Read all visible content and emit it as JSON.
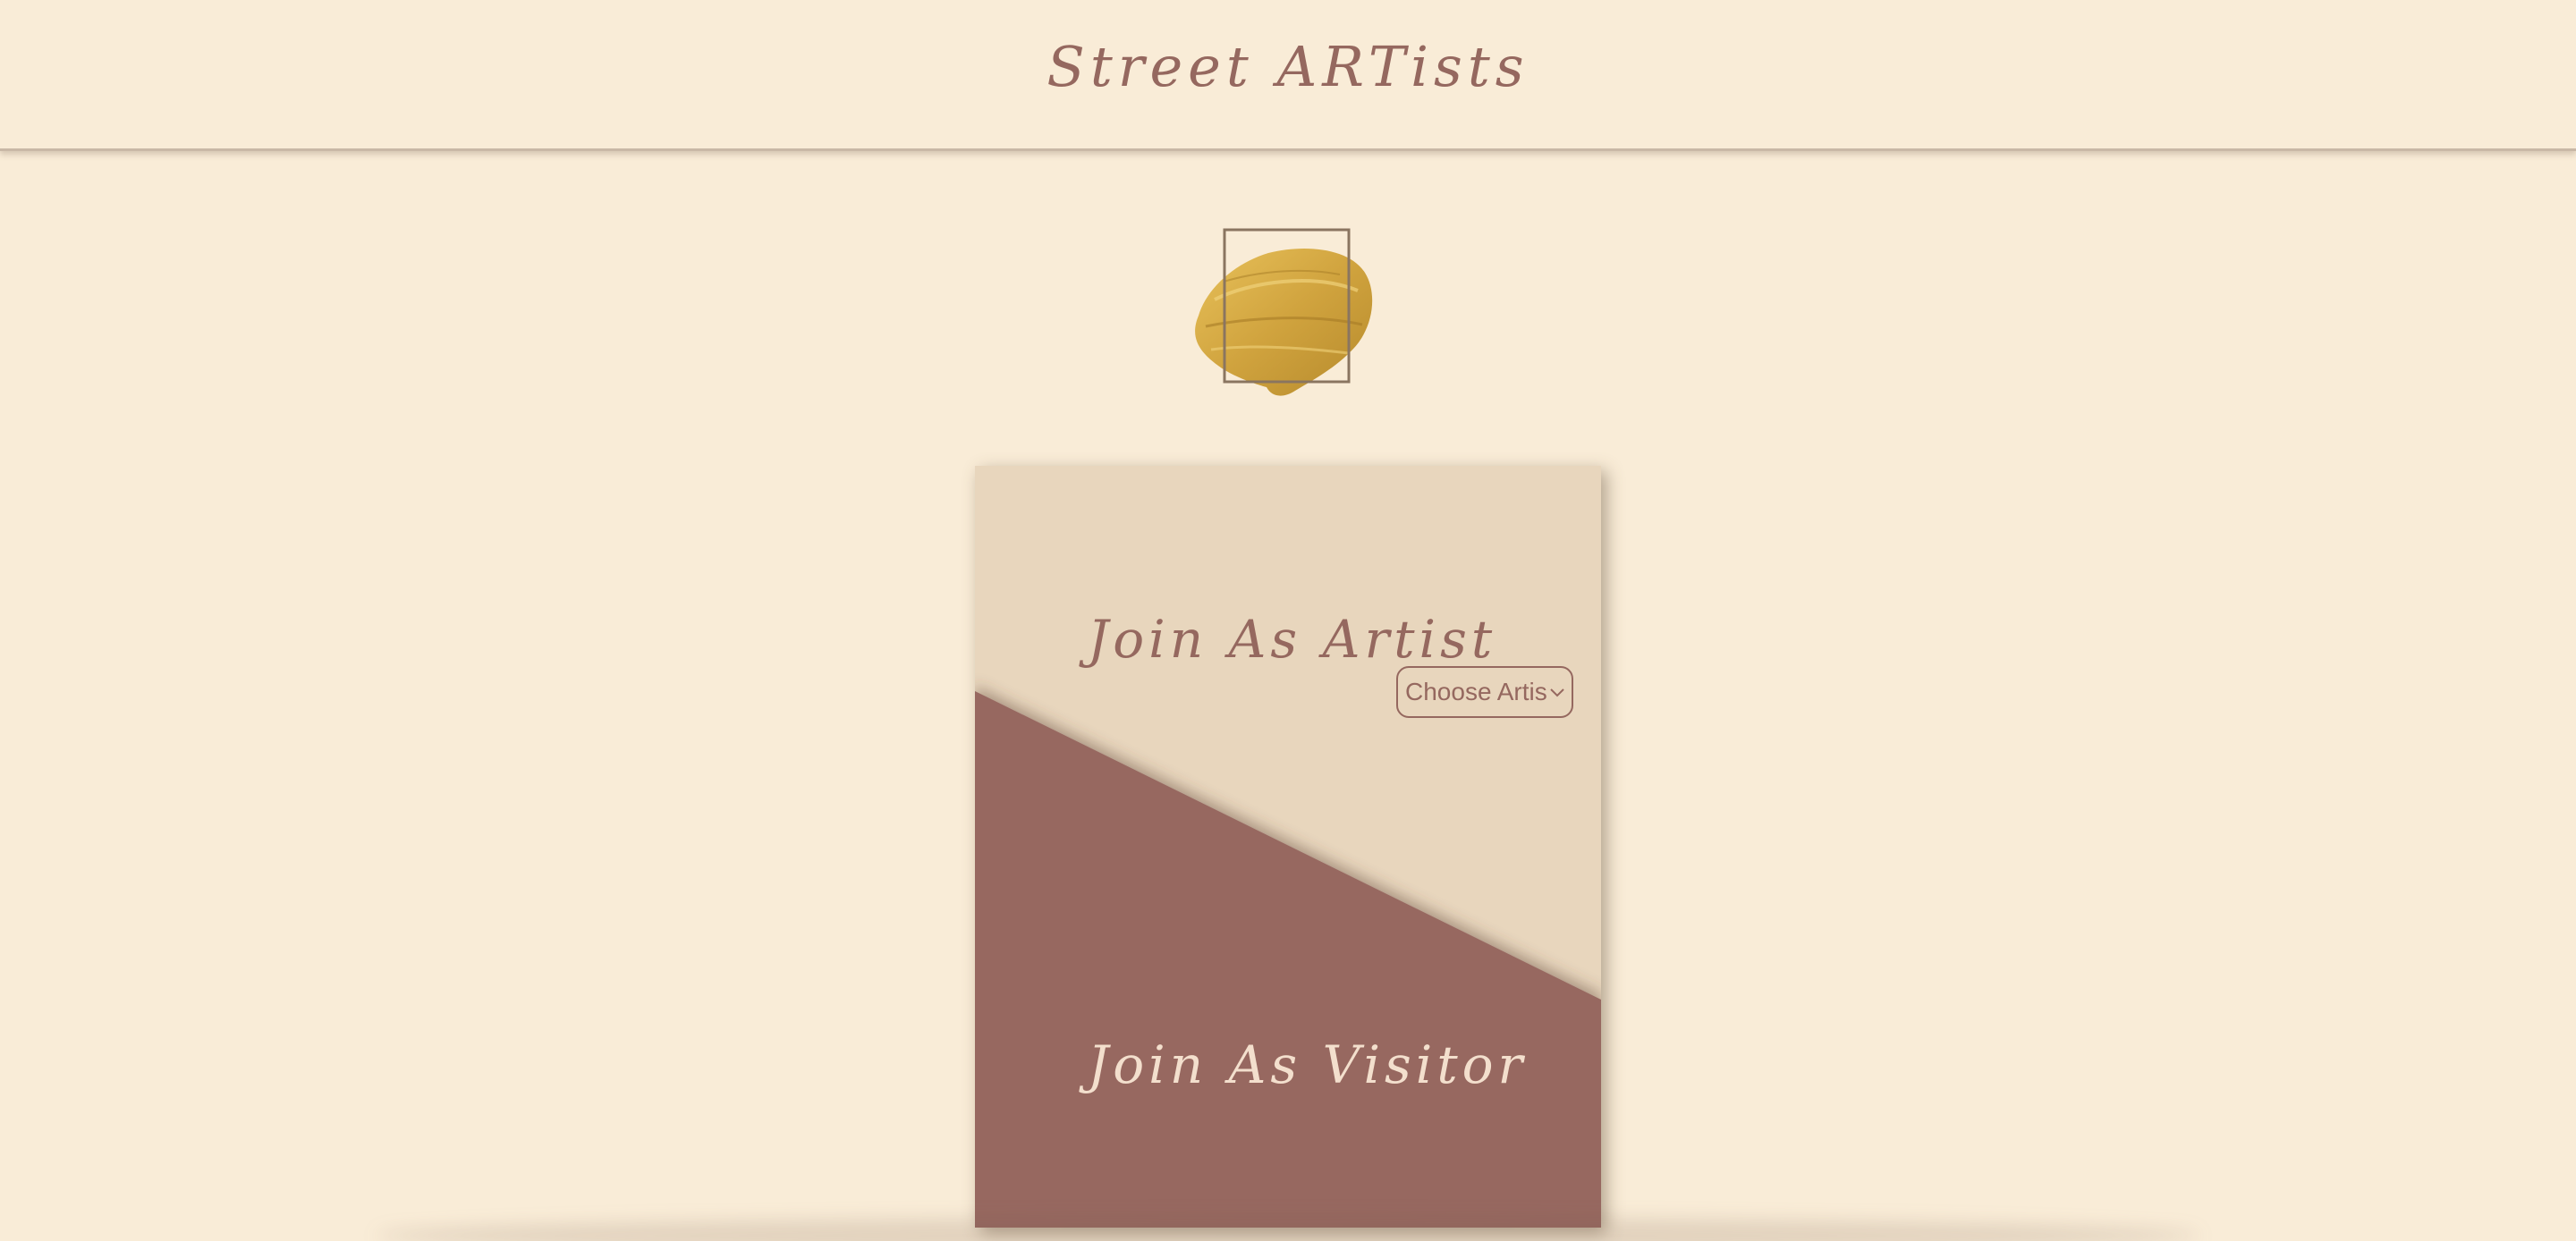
{
  "header": {
    "title": "Street ARTists"
  },
  "logo": {
    "icon": "gold-paint-brush-stroke-icon",
    "colors": {
      "gold": "#d0a33e",
      "frame": "#8a7560"
    }
  },
  "card": {
    "join_artist_label": "Join As Artist",
    "join_visitor_label": "Join As Visitor",
    "artist_select": {
      "value": "Choose Artis",
      "icon": "chevron-down-icon"
    }
  },
  "colors": {
    "background": "#f9ecd7",
    "card_light": "#e8d6bd",
    "card_dark": "#976860",
    "accent_text": "#95685f",
    "light_text": "#f3dfcd"
  }
}
